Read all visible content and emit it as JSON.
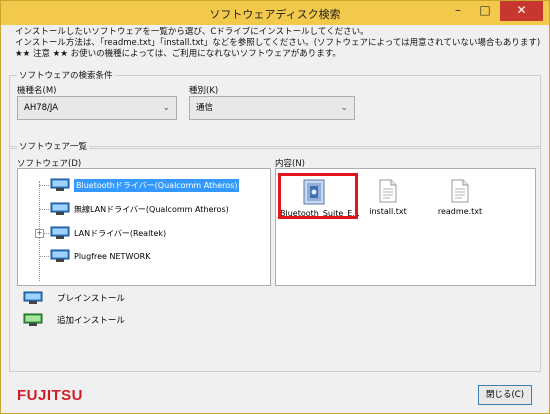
{
  "window": {
    "title": "ソフトウェアディスク検索",
    "minimize_glyph": "–",
    "maximize_glyph": "□",
    "close_glyph": "✕"
  },
  "intro": {
    "line1": "インストールしたいソフトウェアを一覧から選び、Cドライブにインストールしてください。",
    "line2": "インストール方法は、「readme.txt」「install.txt」などを参照してください。(ソフトウェアによっては用意されていない場合もあります)",
    "line3": "★★ 注意 ★★ お使いの機種によっては、ご利用になれないソフトウェアがあります。"
  },
  "search": {
    "group_label": "ソフトウェアの検索条件",
    "model_label": "機種名(M)",
    "model_value": "AH78/JA",
    "category_label": "種別(K)",
    "category_value": "通信"
  },
  "list": {
    "group_label": "ソフトウェア一覧",
    "software_label": "ソフトウェア(D)",
    "contents_label": "内容(N)",
    "software_items": [
      {
        "label": "Bluetoothドライバー(Qualcomm Atheros)",
        "selected": true
      },
      {
        "label": "無線LANドライバー(Qualcomm Atheros)",
        "selected": false
      },
      {
        "label": "LANドライバー(Realtek)",
        "selected": false,
        "expandable": true
      },
      {
        "label": "Plugfree NETWORK",
        "selected": false
      }
    ],
    "files": [
      {
        "name": "Bluetooth_Suite_E...",
        "icon": "installer-icon"
      },
      {
        "name": "install.txt",
        "icon": "text-file-icon"
      },
      {
        "name": "readme.txt",
        "icon": "text-file-icon"
      }
    ]
  },
  "legend": {
    "preinstall": "プレインストール",
    "add_install": "追加インストール"
  },
  "footer": {
    "logo": "FUJITSU",
    "close_button": "閉じる(C)"
  },
  "colors": {
    "titlebar": "#f3c94b",
    "close": "#c7372f",
    "selection": "#3399ff",
    "highlight": "#e3141a",
    "logo": "#d31c27"
  }
}
